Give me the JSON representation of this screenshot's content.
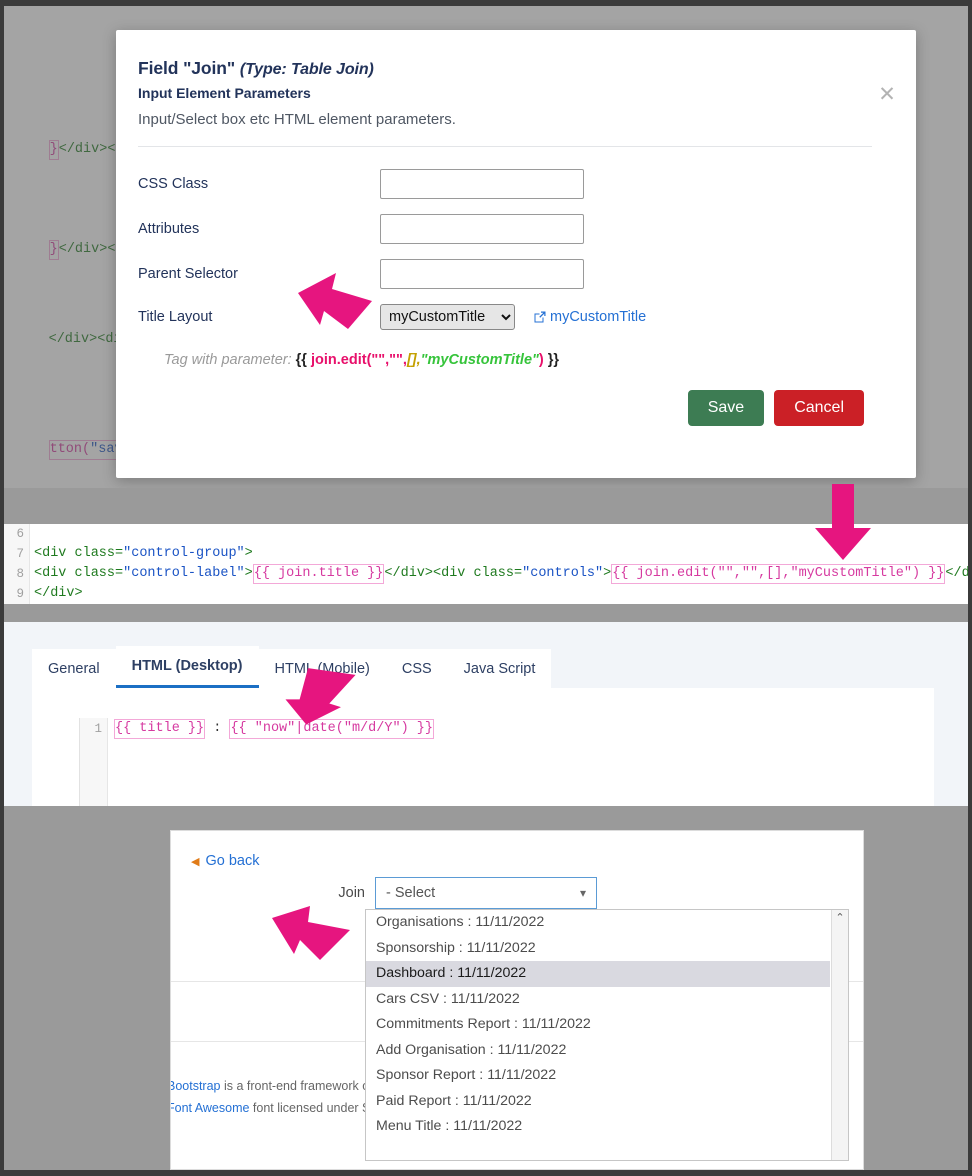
{
  "background_code": {
    "lines": [
      "}</div><div cla",
      "}</div><div cla",
      "</div><div clas",
      "tton(\"saveandcl"
    ]
  },
  "modal": {
    "title_prefix": "Field \"Join\" ",
    "title_type": "(Type: Table Join)",
    "subtitle": "Input Element Parameters",
    "description": "Input/Select box etc HTML element parameters.",
    "close_label": "✕",
    "fields": [
      {
        "label": "CSS Class",
        "value": "",
        "placeholder": ""
      },
      {
        "label": "Attributes",
        "value": "",
        "placeholder": ""
      },
      {
        "label": "Parent Selector",
        "value": "",
        "placeholder": ""
      }
    ],
    "title_layout": {
      "label": "Title Layout",
      "selected": "myCustomTitle",
      "link_text": "myCustomTitle",
      "link_icon": "external-link-icon"
    },
    "tag_hint": {
      "label": "Tag with parameter:",
      "open": "{{ ",
      "fn": "join.edit(",
      "args_quotes": "\"\",\"\",",
      "brackets": "[],",
      "param": "\"myCustomTitle\"",
      "close_paren": ")",
      "close": " }}"
    },
    "buttons": {
      "save": "Save",
      "cancel": "Cancel"
    }
  },
  "code_editor_main": {
    "lines": [
      {
        "num": "6",
        "segments": []
      },
      {
        "num": "7",
        "text": "<div class=\"control-group\">"
      },
      {
        "num": "8",
        "text": "<div class=\"control-label\">{{ join.title }}</div><div class=\"controls\">{{ join.edit(\"\",\"\",[],\"myCustomTitle\") }}</div"
      },
      {
        "num": "9",
        "text": "</div>"
      }
    ],
    "line8": {
      "part1": "<div class=",
      "str1": "\"control-label\"",
      "gt1": ">",
      "mustache1": "{{ join.title }}",
      "mid": "</div><div class=",
      "str2": "\"controls\"",
      "gt2": ">",
      "mustache2": "{{ join.edit(\"\",\"\",[],\"myCustomTitle\") }}",
      "tail": "</div"
    },
    "line7": {
      "part1": "<div class=",
      "str1": "\"control-group\"",
      "gt1": ">"
    },
    "line9": {
      "text": "</div>"
    }
  },
  "tabs": {
    "items": [
      {
        "label": "General",
        "active": false
      },
      {
        "label": "HTML (Desktop)",
        "active": true
      },
      {
        "label": "HTML (Mobile)",
        "active": false
      },
      {
        "label": "CSS",
        "active": false
      },
      {
        "label": "Java Script",
        "active": false
      }
    ]
  },
  "code_editor_tab": {
    "line_number": "1",
    "mustache1": "{{ title }}",
    "separator": " : ",
    "mustache2": "{{ \"now\"|date(\"m/d/Y\") }}"
  },
  "preview": {
    "go_back": "Go back",
    "go_back_icon": "caret-left-icon",
    "join_label": "Join",
    "select_value": "- Select",
    "select_chevron": "chevron-down-icon",
    "options": [
      {
        "label": "Organisations : 11/11/2022",
        "selected": false
      },
      {
        "label": "Sponsorship : 11/11/2022",
        "selected": false
      },
      {
        "label": "Dashboard : 11/11/2022",
        "selected": true
      },
      {
        "label": "Cars CSV : 11/11/2022",
        "selected": false
      },
      {
        "label": "Commitments Report : 11/11/2022",
        "selected": false
      },
      {
        "label": "Add Organisation : 11/11/2022",
        "selected": false
      },
      {
        "label": "Sponsor Report : 11/11/2022",
        "selected": false
      },
      {
        "label": "Paid Report : 11/11/2022",
        "selected": false
      },
      {
        "label": "Menu Title : 11/11/2022",
        "selected": false
      }
    ],
    "scroll_up_icon": "⌃",
    "footer_line1_link": "Bootstrap",
    "footer_line1_rest": " is a front-end framework o",
    "footer_line2_link": "Font Awesome",
    "footer_line2_rest": " font licensed under S"
  },
  "annotations": {
    "arrow_color": "#e6157f",
    "arrows": [
      {
        "name": "arrow-title-layout",
        "direction": "down-right"
      },
      {
        "name": "arrow-code-mustache",
        "direction": "down"
      },
      {
        "name": "arrow-tab-html-mobile",
        "direction": "down-left"
      },
      {
        "name": "arrow-dropdown",
        "direction": "right-down"
      }
    ]
  }
}
